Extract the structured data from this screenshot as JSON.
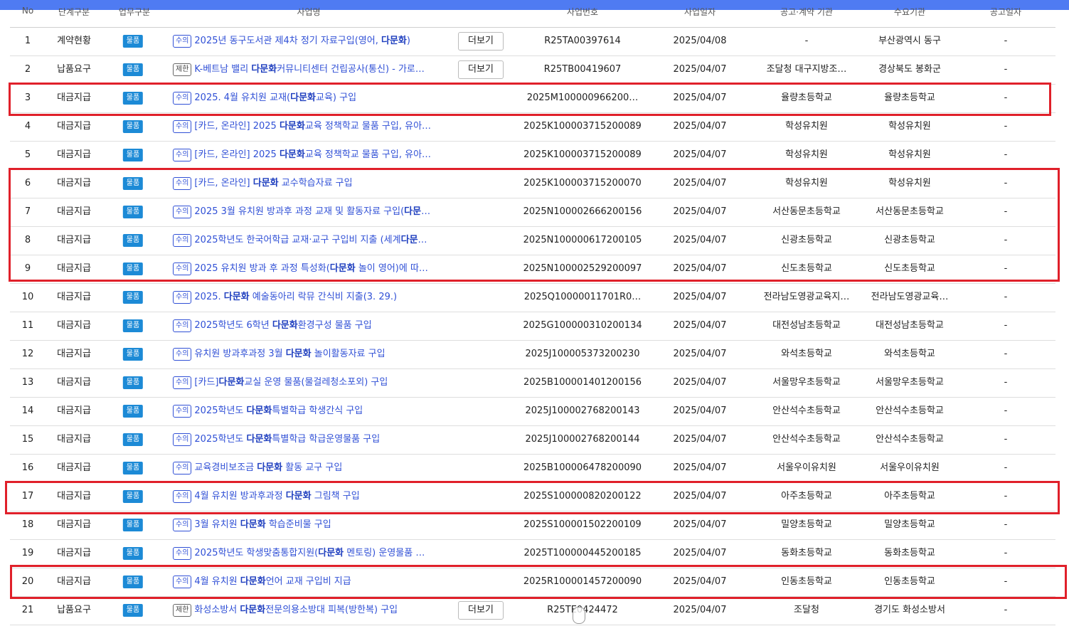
{
  "header": {
    "no": "No",
    "kind": "단계구분",
    "biz": "업무구분",
    "title": "사업명",
    "number": "사업번호",
    "date": "사업일자",
    "org1": "공고·계약 기관",
    "org2": "수요기관",
    "gong": "공고일자"
  },
  "more_label": "더보기",
  "rows": [
    {
      "no": "1",
      "kind": "계약현황",
      "badge": "물품",
      "tag": "수의",
      "pre": "2025년 동구도서관 제4차 정기 자료구입(영어, ",
      "kw": "다문화",
      "post": ")",
      "more": true,
      "number": "R25TA00397614",
      "date": "2025/04/08",
      "org1": "-",
      "org2": "부산광역시 동구",
      "gong": "-"
    },
    {
      "no": "2",
      "kind": "납품요구",
      "badge": "물품",
      "tag": "제한",
      "pre": "K-베트남 밸리 ",
      "kw": "다문화",
      "post": "커뮤니티센터 건립공사(통신) - 가로…",
      "more": true,
      "number": "R25TB00419607",
      "date": "2025/04/07",
      "org1": "조달청 대구지방조…",
      "org2": "경상북도 봉화군",
      "gong": "-"
    },
    {
      "no": "3",
      "kind": "대금지급",
      "badge": "물품",
      "tag": "수의",
      "pre": "2025. 4월 유치원 교재(",
      "kw": "다문화",
      "post": "교육) 구입",
      "more": false,
      "number": "2025M100000966200…",
      "date": "2025/04/07",
      "org1": "율량초등학교",
      "org2": "율량초등학교",
      "gong": "-"
    },
    {
      "no": "4",
      "kind": "대금지급",
      "badge": "물품",
      "tag": "수의",
      "pre": "[카드, 온라인] 2025 ",
      "kw": "다문화",
      "post": "교육 정책학교 물품 구입, 유아…",
      "more": false,
      "number": "2025K100003715200089",
      "date": "2025/04/07",
      "org1": "학성유치원",
      "org2": "학성유치원",
      "gong": "-"
    },
    {
      "no": "5",
      "kind": "대금지급",
      "badge": "물품",
      "tag": "수의",
      "pre": "[카드, 온라인] 2025 ",
      "kw": "다문화",
      "post": "교육 정책학교 물품 구입, 유아…",
      "more": false,
      "number": "2025K100003715200089",
      "date": "2025/04/07",
      "org1": "학성유치원",
      "org2": "학성유치원",
      "gong": "-"
    },
    {
      "no": "6",
      "kind": "대금지급",
      "badge": "물품",
      "tag": "수의",
      "pre": "[카드, 온라인] ",
      "kw": "다문화",
      "post": " 교수학습자료 구입",
      "more": false,
      "number": "2025K100003715200070",
      "date": "2025/04/07",
      "org1": "학성유치원",
      "org2": "학성유치원",
      "gong": "-"
    },
    {
      "no": "7",
      "kind": "대금지급",
      "badge": "물품",
      "tag": "수의",
      "pre": "2025 3월 유치원 방과후 과정 교재 및 활동자료 구입(",
      "kw": "다문",
      "post": "…",
      "more": false,
      "number": "2025N100002666200156",
      "date": "2025/04/07",
      "org1": "서산동문초등학교",
      "org2": "서산동문초등학교",
      "gong": "-"
    },
    {
      "no": "8",
      "kind": "대금지급",
      "badge": "물품",
      "tag": "수의",
      "pre": "2025학년도 한국어학급 교재·교구 구입비 지출 (세계",
      "kw": "다문",
      "post": "…",
      "more": false,
      "number": "2025N100000617200105",
      "date": "2025/04/07",
      "org1": "신광초등학교",
      "org2": "신광초등학교",
      "gong": "-"
    },
    {
      "no": "9",
      "kind": "대금지급",
      "badge": "물품",
      "tag": "수의",
      "pre": "2025 유치원 방과 후 과정 특성화(",
      "kw": "다문화",
      "post": " 놀이 영어)에 따…",
      "more": false,
      "number": "2025N100002529200097",
      "date": "2025/04/07",
      "org1": "신도초등학교",
      "org2": "신도초등학교",
      "gong": "-"
    },
    {
      "no": "10",
      "kind": "대금지급",
      "badge": "물품",
      "tag": "수의",
      "pre": "2025. ",
      "kw": "다문화",
      "post": " 예술동아리 락뮤 간식비 지출(3. 29.)",
      "more": false,
      "number": "2025Q10000011701R0…",
      "date": "2025/04/07",
      "org1": "전라남도영광교육지…",
      "org2": "전라남도영광교육…",
      "gong": "-"
    },
    {
      "no": "11",
      "kind": "대금지급",
      "badge": "물품",
      "tag": "수의",
      "pre": "2025학년도 6학년 ",
      "kw": "다문화",
      "post": "환경구성 물품 구입",
      "more": false,
      "number": "2025G100000310200134",
      "date": "2025/04/07",
      "org1": "대전성남초등학교",
      "org2": "대전성남초등학교",
      "gong": "-"
    },
    {
      "no": "12",
      "kind": "대금지급",
      "badge": "물품",
      "tag": "수의",
      "pre": "유치원 방과후과정 3월 ",
      "kw": "다문화",
      "post": " 놀이활동자료 구입",
      "more": false,
      "number": "2025J100005373200230",
      "date": "2025/04/07",
      "org1": "와석초등학교",
      "org2": "와석초등학교",
      "gong": "-"
    },
    {
      "no": "13",
      "kind": "대금지급",
      "badge": "물품",
      "tag": "수의",
      "pre": "[카드]",
      "kw": "다문화",
      "post": "교실 운영 물품(물걸레청소포외) 구입",
      "more": false,
      "number": "2025B100001401200156",
      "date": "2025/04/07",
      "org1": "서울망우초등학교",
      "org2": "서울망우초등학교",
      "gong": "-"
    },
    {
      "no": "14",
      "kind": "대금지급",
      "badge": "물품",
      "tag": "수의",
      "pre": "2025학년도 ",
      "kw": "다문화",
      "post": "특별학급 학생간식 구입",
      "more": false,
      "number": "2025J100002768200143",
      "date": "2025/04/07",
      "org1": "안산석수초등학교",
      "org2": "안산석수초등학교",
      "gong": "-"
    },
    {
      "no": "15",
      "kind": "대금지급",
      "badge": "물품",
      "tag": "수의",
      "pre": "2025학년도 ",
      "kw": "다문화",
      "post": "특별학급 학급운영물품 구입",
      "more": false,
      "number": "2025J100002768200144",
      "date": "2025/04/07",
      "org1": "안산석수초등학교",
      "org2": "안산석수초등학교",
      "gong": "-"
    },
    {
      "no": "16",
      "kind": "대금지급",
      "badge": "물품",
      "tag": "수의",
      "pre": "교육경비보조금 ",
      "kw": "다문화",
      "post": " 활동 교구 구입",
      "more": false,
      "number": "2025B100006478200090",
      "date": "2025/04/07",
      "org1": "서울우이유치원",
      "org2": "서울우이유치원",
      "gong": "-"
    },
    {
      "no": "17",
      "kind": "대금지급",
      "badge": "물품",
      "tag": "수의",
      "pre": "4월 유치원 방과후과정 ",
      "kw": "다문화",
      "post": " 그림책 구입",
      "more": false,
      "number": "2025S100000820200122",
      "date": "2025/04/07",
      "org1": "아주초등학교",
      "org2": "아주초등학교",
      "gong": "-"
    },
    {
      "no": "18",
      "kind": "대금지급",
      "badge": "물품",
      "tag": "수의",
      "pre": "3월 유치원 ",
      "kw": "다문화",
      "post": " 학습준비물 구입",
      "more": false,
      "number": "2025S100001502200109",
      "date": "2025/04/07",
      "org1": "밀양초등학교",
      "org2": "밀양초등학교",
      "gong": "-"
    },
    {
      "no": "19",
      "kind": "대금지급",
      "badge": "물품",
      "tag": "수의",
      "pre": "2025학년도 학생맞춤통합지원(",
      "kw": "다문화",
      "post": " 멘토링) 운영물품 …",
      "more": false,
      "number": "2025T100000445200185",
      "date": "2025/04/07",
      "org1": "동화초등학교",
      "org2": "동화초등학교",
      "gong": "-"
    },
    {
      "no": "20",
      "kind": "대금지급",
      "badge": "물품",
      "tag": "수의",
      "pre": "4월 유치원 ",
      "kw": "다문화",
      "post": "언어 교재 구입비 지급",
      "more": false,
      "number": "2025R100001457200090",
      "date": "2025/04/07",
      "org1": "인동초등학교",
      "org2": "인동초등학교",
      "gong": "-"
    },
    {
      "no": "21",
      "kind": "납품요구",
      "badge": "물품",
      "tag": "제한",
      "pre": "화성소방서 ",
      "kw": "다문화",
      "post": "전문의용소방대 피복(방한복) 구입",
      "more": true,
      "number": "R25TE0424472",
      "date": "2025/04/07",
      "org1": "조달청",
      "org2": "경기도 화성소방서",
      "gong": "-"
    }
  ],
  "highlight_color": "#e0202a",
  "accent_color": "#3050d6"
}
